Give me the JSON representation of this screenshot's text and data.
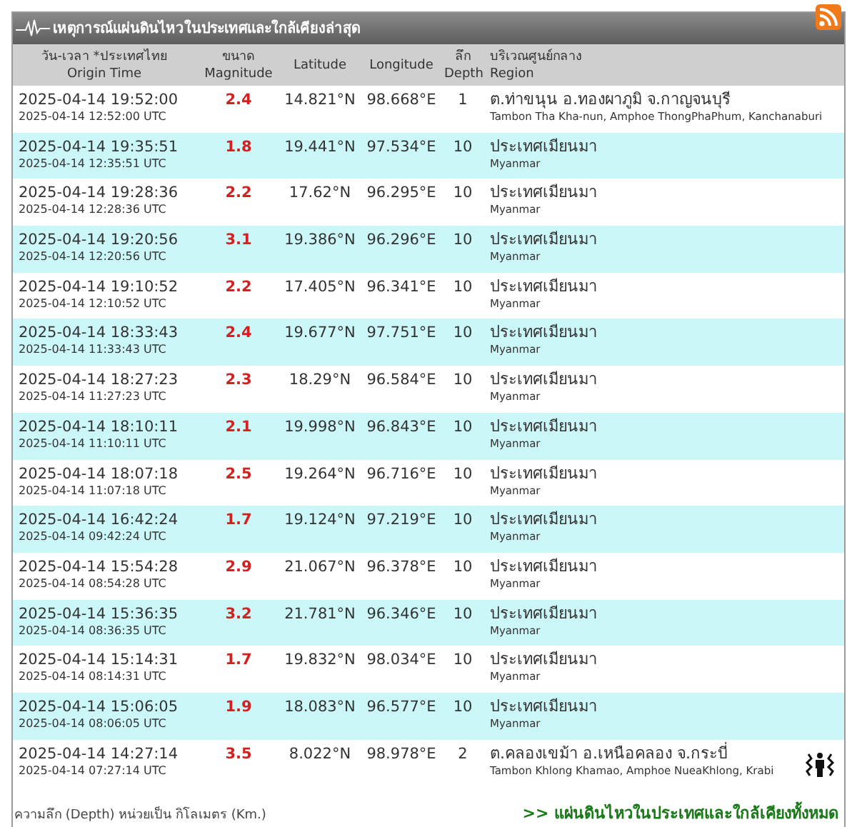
{
  "header": {
    "title": "เหตุการณ์แผ่นดินไหวในประเทศและใกล้เคียงล่าสุด"
  },
  "columns": [
    {
      "th": "วัน-เวลา *ประเทศไทย",
      "en": "Origin Time"
    },
    {
      "th": "ขนาด",
      "en": "Magnitude"
    },
    {
      "en": "Latitude"
    },
    {
      "en": "Longitude"
    },
    {
      "th": "ลึก",
      "en": "Depth"
    },
    {
      "th": "บริเวณศูนย์กลาง",
      "en": "Region"
    }
  ],
  "rows": [
    {
      "local": "2025-04-14 19:52:00",
      "utc": "2025-04-14 12:52:00 UTC",
      "magnitude": "2.4",
      "lat": "14.821°N",
      "lon": "98.668°E",
      "depth": "1",
      "region_th": "ต.ท่าขนุน อ.ทองผาภูมิ จ.กาญจนบุรี",
      "region_en": "Tambon Tha Kha-nun, Amphoe ThongPhaPhum, Kanchanaburi",
      "felt": false
    },
    {
      "local": "2025-04-14 19:35:51",
      "utc": "2025-04-14 12:35:51 UTC",
      "magnitude": "1.8",
      "lat": "19.441°N",
      "lon": "97.534°E",
      "depth": "10",
      "region_th": "ประเทศเมียนมา",
      "region_en": "Myanmar",
      "felt": false
    },
    {
      "local": "2025-04-14 19:28:36",
      "utc": "2025-04-14 12:28:36 UTC",
      "magnitude": "2.2",
      "lat": "17.62°N",
      "lon": "96.295°E",
      "depth": "10",
      "region_th": "ประเทศเมียนมา",
      "region_en": "Myanmar",
      "felt": false
    },
    {
      "local": "2025-04-14 19:20:56",
      "utc": "2025-04-14 12:20:56 UTC",
      "magnitude": "3.1",
      "lat": "19.386°N",
      "lon": "96.296°E",
      "depth": "10",
      "region_th": "ประเทศเมียนมา",
      "region_en": "Myanmar",
      "felt": false
    },
    {
      "local": "2025-04-14 19:10:52",
      "utc": "2025-04-14 12:10:52 UTC",
      "magnitude": "2.2",
      "lat": "17.405°N",
      "lon": "96.341°E",
      "depth": "10",
      "region_th": "ประเทศเมียนมา",
      "region_en": "Myanmar",
      "felt": false
    },
    {
      "local": "2025-04-14 18:33:43",
      "utc": "2025-04-14 11:33:43 UTC",
      "magnitude": "2.4",
      "lat": "19.677°N",
      "lon": "97.751°E",
      "depth": "10",
      "region_th": "ประเทศเมียนมา",
      "region_en": "Myanmar",
      "felt": false
    },
    {
      "local": "2025-04-14 18:27:23",
      "utc": "2025-04-14 11:27:23 UTC",
      "magnitude": "2.3",
      "lat": "18.29°N",
      "lon": "96.584°E",
      "depth": "10",
      "region_th": "ประเทศเมียนมา",
      "region_en": "Myanmar",
      "felt": false
    },
    {
      "local": "2025-04-14 18:10:11",
      "utc": "2025-04-14 11:10:11 UTC",
      "magnitude": "2.1",
      "lat": "19.998°N",
      "lon": "96.843°E",
      "depth": "10",
      "region_th": "ประเทศเมียนมา",
      "region_en": "Myanmar",
      "felt": false
    },
    {
      "local": "2025-04-14 18:07:18",
      "utc": "2025-04-14 11:07:18 UTC",
      "magnitude": "2.5",
      "lat": "19.264°N",
      "lon": "96.716°E",
      "depth": "10",
      "region_th": "ประเทศเมียนมา",
      "region_en": "Myanmar",
      "felt": false
    },
    {
      "local": "2025-04-14 16:42:24",
      "utc": "2025-04-14 09:42:24 UTC",
      "magnitude": "1.7",
      "lat": "19.124°N",
      "lon": "97.219°E",
      "depth": "10",
      "region_th": "ประเทศเมียนมา",
      "region_en": "Myanmar",
      "felt": false
    },
    {
      "local": "2025-04-14 15:54:28",
      "utc": "2025-04-14 08:54:28 UTC",
      "magnitude": "2.9",
      "lat": "21.067°N",
      "lon": "96.378°E",
      "depth": "10",
      "region_th": "ประเทศเมียนมา",
      "region_en": "Myanmar",
      "felt": false
    },
    {
      "local": "2025-04-14 15:36:35",
      "utc": "2025-04-14 08:36:35 UTC",
      "magnitude": "3.2",
      "lat": "21.781°N",
      "lon": "96.346°E",
      "depth": "10",
      "region_th": "ประเทศเมียนมา",
      "region_en": "Myanmar",
      "felt": false
    },
    {
      "local": "2025-04-14 15:14:31",
      "utc": "2025-04-14 08:14:31 UTC",
      "magnitude": "1.7",
      "lat": "19.832°N",
      "lon": "98.034°E",
      "depth": "10",
      "region_th": "ประเทศเมียนมา",
      "region_en": "Myanmar",
      "felt": false
    },
    {
      "local": "2025-04-14 15:06:05",
      "utc": "2025-04-14 08:06:05 UTC",
      "magnitude": "1.9",
      "lat": "18.083°N",
      "lon": "96.577°E",
      "depth": "10",
      "region_th": "ประเทศเมียนมา",
      "region_en": "Myanmar",
      "felt": false
    },
    {
      "local": "2025-04-14 14:27:14",
      "utc": "2025-04-14 07:27:14 UTC",
      "magnitude": "3.5",
      "lat": "8.022°N",
      "lon": "98.978°E",
      "depth": "2",
      "region_th": "ต.คลองเขม้า อ.เหนือคลอง จ.กระบี่",
      "region_en": "Tambon Khlong Khamao, Amphoe NueaKhlong, Krabi",
      "felt": true
    }
  ],
  "footer": {
    "note": "ความลึก (Depth) หน่วยเป็น กิโลเมตร (Km.)",
    "link": ">> แผ่นดินไหวในประเทศและใกล้เคียงทั้งหมด"
  }
}
